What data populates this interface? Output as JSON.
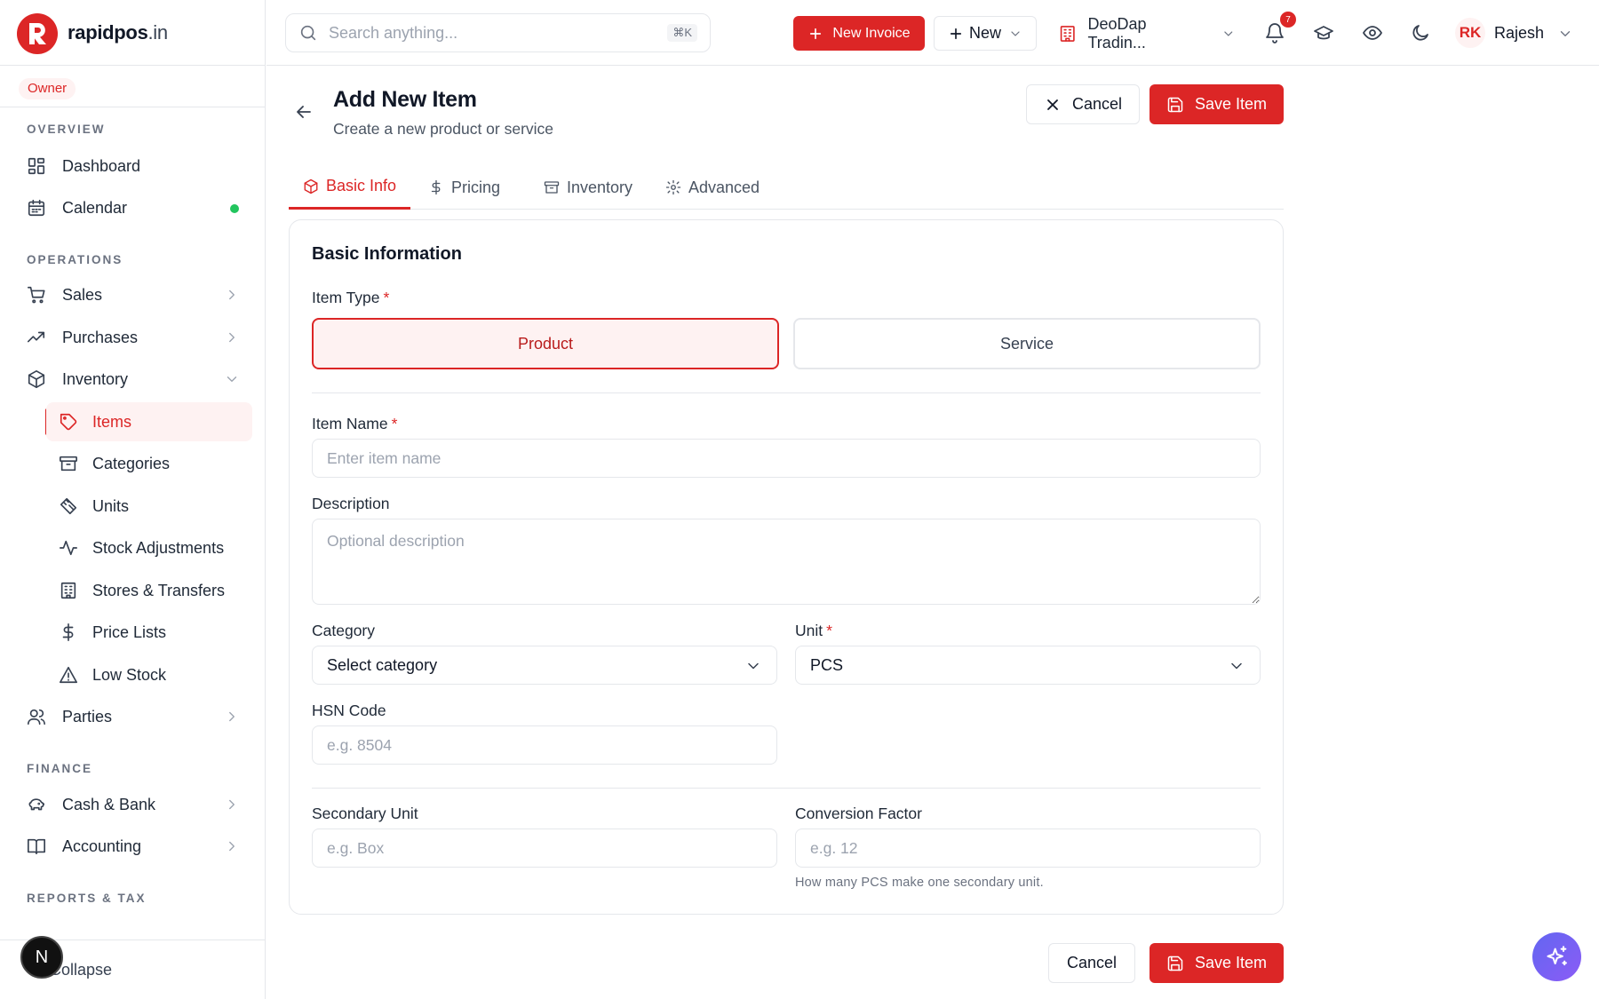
{
  "brand": {
    "name": "rapidpos",
    "tld": ".in"
  },
  "role": "Owner",
  "sidebar": {
    "overview_title": "OVERVIEW",
    "operations_title": "OPERATIONS",
    "finance_title": "FINANCE",
    "reports_title": "REPORTS & TAX",
    "dashboard": "Dashboard",
    "calendar": "Calendar",
    "sales": "Sales",
    "purchases": "Purchases",
    "inventory": "Inventory",
    "inventory_sub": [
      "Items",
      "Categories",
      "Units",
      "Stock Adjustments",
      "Stores & Transfers",
      "Price Lists",
      "Low Stock"
    ],
    "parties": "Parties",
    "cash_bank": "Cash & Bank",
    "accounting": "Accounting",
    "collapse": "Collapse",
    "n_badge": "N"
  },
  "topbar": {
    "search_placeholder": "Search anything...",
    "search_shortcut": "⌘K",
    "new_invoice": "New Invoice",
    "new": "New",
    "company": "DeoDap Tradin...",
    "notifications_count": "7",
    "user_initials": "RK",
    "user_name": "Rajesh"
  },
  "page": {
    "title": "Add New Item",
    "subtitle": "Create a new product or service",
    "cancel": "Cancel",
    "save": "Save Item"
  },
  "tabs": [
    "Basic Info",
    "Pricing",
    "Inventory",
    "Advanced"
  ],
  "form": {
    "section_title": "Basic Information",
    "item_type_label": "Item Type",
    "item_type_options": [
      "Product",
      "Service"
    ],
    "item_type_selected": "Product",
    "item_name_label": "Item Name",
    "item_name_placeholder": "Enter item name",
    "description_label": "Description",
    "description_placeholder": "Optional description",
    "category_label": "Category",
    "category_value": "Select category",
    "unit_label": "Unit",
    "unit_value": "PCS",
    "hsn_label": "HSN Code",
    "hsn_placeholder": "e.g. 8504",
    "secondary_unit_label": "Secondary Unit",
    "secondary_unit_placeholder": "e.g. Box",
    "conversion_label": "Conversion Factor",
    "conversion_placeholder": "e.g. 12",
    "conversion_help": "How many PCS make one secondary unit.",
    "required_mark": "*"
  },
  "colors": {
    "accent": "#dc2626",
    "accent_light": "#fef2f2",
    "success": "#22c55e"
  }
}
